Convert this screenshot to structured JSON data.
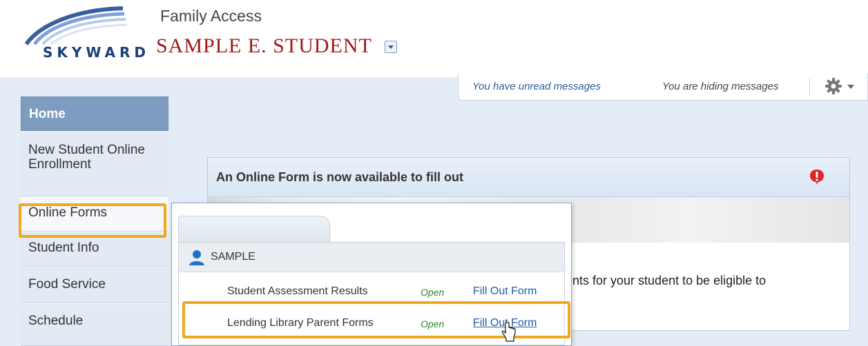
{
  "header": {
    "logo_text": "SKYWARD",
    "app_title": "Family Access",
    "student_name": "SAMPLE E. STUDENT"
  },
  "messages": {
    "unread": "You have unread messages",
    "hiding": "You are hiding messages",
    "settings_icon": "gear-icon"
  },
  "sidebar": {
    "items": [
      {
        "label": "Home",
        "active": true
      },
      {
        "label": "New Student Online Enrollment"
      },
      {
        "label": "Online Forms"
      },
      {
        "label": "Student Info"
      },
      {
        "label": "Food Service"
      },
      {
        "label": "Schedule"
      }
    ]
  },
  "panel": {
    "title": "An Online Form is now available to fill out",
    "alert_icon": "exclamation-icon",
    "body_fragment": "ents for your student to be eligible to"
  },
  "popup": {
    "student_label": "SAMPLE",
    "forms": [
      {
        "name": "Student Assessment Results",
        "status": "Open",
        "action": "Fill Out Form"
      },
      {
        "name": "Lending Library Parent Forms",
        "status": "Open",
        "action": "Fill Out Form"
      }
    ]
  },
  "colors": {
    "accent_highlight": "#f2a81d",
    "student_name": "#a01818",
    "link": "#1f5aa6",
    "status_open": "#2a8a2a",
    "home_active": "#7d9cc0"
  }
}
